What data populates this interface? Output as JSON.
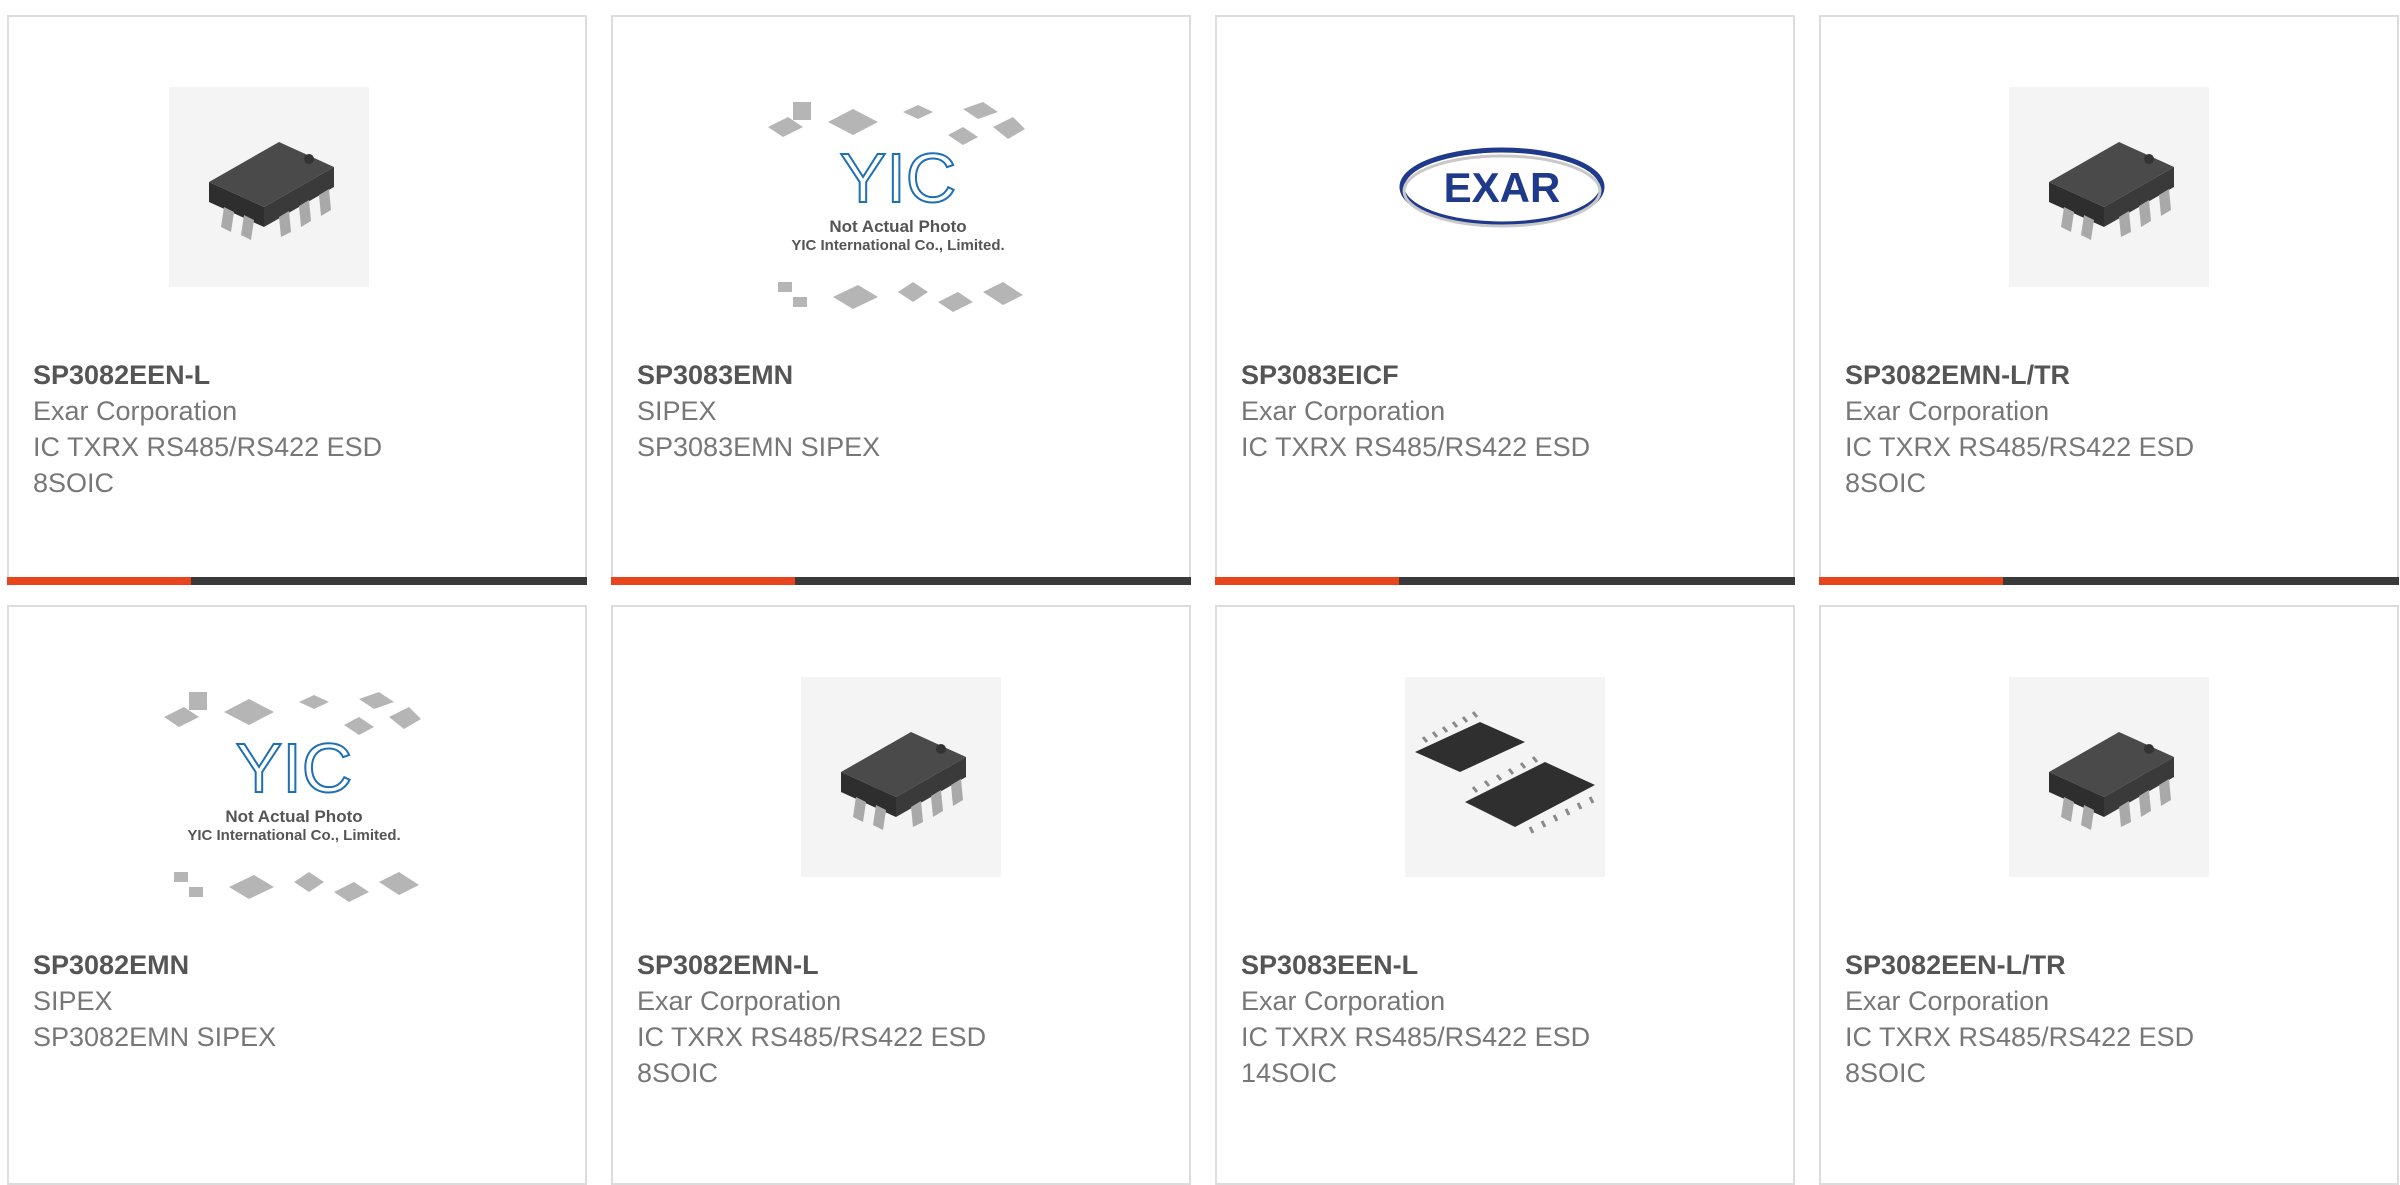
{
  "products": [
    {
      "part": "SP3082EEN-L",
      "maker": "Exar Corporation",
      "desc1": "IC TXRX RS485/RS422 ESD",
      "desc2": "8SOIC",
      "image": "soic8-chip"
    },
    {
      "part": "SP3083EMN",
      "maker": "SIPEX",
      "desc1": "SP3083EMN SIPEX",
      "desc2": "",
      "image": "yic-placeholder",
      "image_text": [
        "YIC",
        "Not Actual Photo",
        "YIC International Co., Limited."
      ]
    },
    {
      "part": "SP3083EICF",
      "maker": "Exar Corporation",
      "desc1": "IC TXRX RS485/RS422 ESD",
      "desc2": "",
      "image": "exar-logo",
      "image_text": [
        "EXAR"
      ]
    },
    {
      "part": "SP3082EMN-L/TR",
      "maker": "Exar Corporation",
      "desc1": "IC TXRX RS485/RS422 ESD",
      "desc2": "8SOIC",
      "image": "soic8-chip"
    },
    {
      "part": "SP3082EMN",
      "maker": "SIPEX",
      "desc1": "SP3082EMN SIPEX",
      "desc2": "",
      "image": "yic-placeholder",
      "image_text": [
        "YIC",
        "Not Actual Photo",
        "YIC International Co., Limited."
      ]
    },
    {
      "part": "SP3082EMN-L",
      "maker": "Exar Corporation",
      "desc1": "IC TXRX RS485/RS422 ESD",
      "desc2": "8SOIC",
      "image": "soic8-chip"
    },
    {
      "part": "SP3083EEN-L",
      "maker": "Exar Corporation",
      "desc1": "IC TXRX RS485/RS422 ESD",
      "desc2": "14SOIC",
      "image": "soic14-pair"
    },
    {
      "part": "SP3082EEN-L/TR",
      "maker": "Exar Corporation",
      "desc1": "IC TXRX RS485/RS422 ESD",
      "desc2": "8SOIC",
      "image": "soic8-chip"
    }
  ],
  "colors": {
    "accent": "#e8451c",
    "bar": "#3a3a3a",
    "border": "#dcdcdc",
    "logo_blue": "#1f3a8a",
    "yic_blue": "#1e6fb5"
  }
}
